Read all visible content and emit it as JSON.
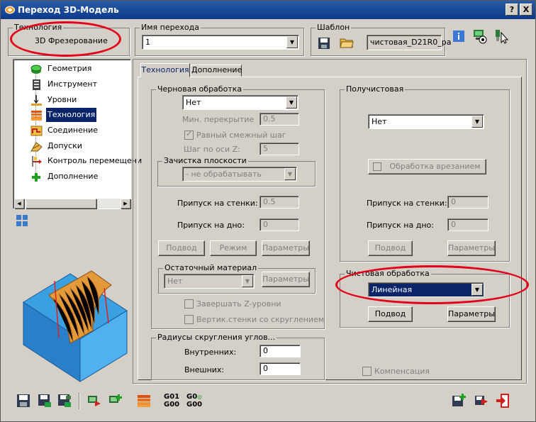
{
  "window": {
    "title": "Переход 3D-Модель",
    "help_label": "?",
    "close_label": "X"
  },
  "technology": {
    "label": "Технология",
    "value": "3D Фрезерование"
  },
  "transition_name": {
    "label": "Имя перехода",
    "value": "1"
  },
  "template": {
    "label": "Шаблон",
    "value": "чистовая_D21R0_ра"
  },
  "tree": {
    "items": [
      {
        "label": "Геометрия",
        "icon": "geometry-icon"
      },
      {
        "label": "Инструмент",
        "icon": "tool-icon"
      },
      {
        "label": "Уровни",
        "icon": "levels-icon"
      },
      {
        "label": "Технология",
        "icon": "technology-icon",
        "selected": true
      },
      {
        "label": "Соединение",
        "icon": "connection-icon"
      },
      {
        "label": "Допуски",
        "icon": "tolerances-icon"
      },
      {
        "label": "Контроль перемещени",
        "icon": "movement-control-icon"
      },
      {
        "label": "Дополнение",
        "icon": "addition-icon"
      }
    ]
  },
  "tabs": [
    {
      "label": "Технология",
      "active": true
    },
    {
      "label": "Дополнение",
      "active": false
    }
  ],
  "rough": {
    "label": "Черновая обработка",
    "mode_value": "Нет",
    "min_overlap_label": "Мин. перекрытие",
    "min_overlap_value": "0.5",
    "equal_step_label": "Равный смежный шаг",
    "z_step_label": "Шаг по оси Z:",
    "z_step_value": "5",
    "plane_cleanup_label": "Зачистка плоскости",
    "plane_cleanup_value": "- не обрабатывать",
    "wall_allowance_label": "Припуск на стенки:",
    "wall_allowance_value": "0.5",
    "bottom_allowance_label": "Припуск на дно:",
    "bottom_allowance_value": "0",
    "approach_label": "Подвод",
    "mode_label": "Режим",
    "params_label": "Параметры",
    "rest_material_label": "Остаточный материал",
    "rest_material_value": "Нет",
    "rest_params_label": "Параметры",
    "finish_z_label": "Завершать Z-уровни",
    "vertical_walls_label": "Вертик.стенки со скруглением"
  },
  "semi_finish": {
    "label": "Получистовая",
    "mode_value": "Нет",
    "plunge_label": "Обработка врезанием",
    "wall_allowance_label": "Припуск на стенки:",
    "wall_allowance_value": "0",
    "bottom_allowance_label": "Припуск на дно:",
    "bottom_allowance_value": "0",
    "approach_label": "Подвод",
    "params_label": "Параметры"
  },
  "finish": {
    "label": "Чистовая обработка",
    "mode_value": "Линейная",
    "approach_label": "Подвод",
    "params_label": "Параметры"
  },
  "corner_radii": {
    "label": "Радиусы скругления углов...",
    "inner_label": "Внутренних:",
    "inner_value": "0",
    "outer_label": "Внешних:",
    "outer_value": "0"
  },
  "compensation_label": "Компенсация",
  "bottom_toolbar": {
    "g01_label": "G01",
    "g00_label": "G00",
    "g0_label": "G0",
    "g00b_label": "G00"
  },
  "colors": {
    "title_bar": "#0b3a8a",
    "highlight_oval": "#e2001a",
    "selection": "#0a246a",
    "model_blue": "#3aa0e0",
    "model_orange": "#e39a3b"
  }
}
